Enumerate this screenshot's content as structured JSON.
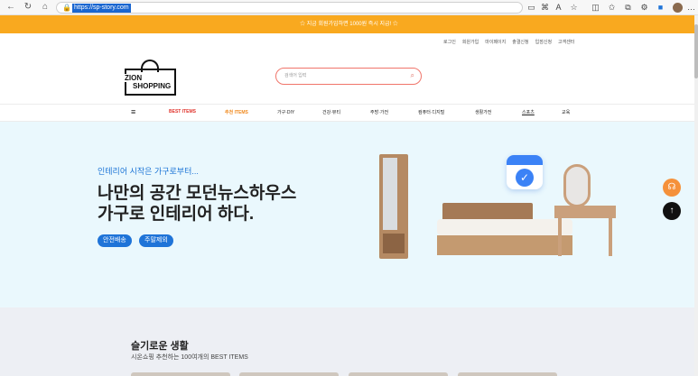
{
  "browser": {
    "url": "https://sp-story.com",
    "nav_icons": [
      "back-arrow-icon",
      "refresh-icon",
      "home-icon"
    ],
    "toolbar_icons": [
      "reader-icon",
      "translate-icon",
      "read-aloud-icon",
      "favorite-icon",
      "split-icon",
      "favorites-icon",
      "collections-icon",
      "extensions-icon",
      "ai-icon",
      "profile-icon",
      "more-icon"
    ]
  },
  "banner": {
    "text": "☆ 지금 회원가입하면 1000원 즉시 지급! ☆",
    "color": "#f9a91f"
  },
  "top_links": [
    "로그인",
    "회원가입",
    "마이페이지",
    "출결신청",
    "입점신청",
    "고객센터"
  ],
  "header": {
    "logo_line1": "ZION",
    "logo_line2": "SHOPPING",
    "search_placeholder": "검색어 입력"
  },
  "nav": {
    "items": [
      "BEST ITEMS",
      "추천 ITEMS",
      "가구·DIY",
      "건강·뷰티",
      "주방·가전",
      "컴퓨터·디지털",
      "생활가전",
      "스포츠",
      "교육"
    ]
  },
  "hero": {
    "subtitle": "인테리어 시작은 가구로부터...",
    "title_line1": "나만의 공간 모던뉴스하우스",
    "title_line2": "가구로 인테리어 하다.",
    "pills": [
      "안전배송",
      "주말제외"
    ],
    "accent": "#1f74d8",
    "background": "#eaf8fd"
  },
  "floating": {
    "chat_color": "#f5913a",
    "top_color": "#111111"
  },
  "section": {
    "title": "슬기로운 생활",
    "description": "시온쇼핑 추천하는 100여개의 BEST ITEMS"
  }
}
